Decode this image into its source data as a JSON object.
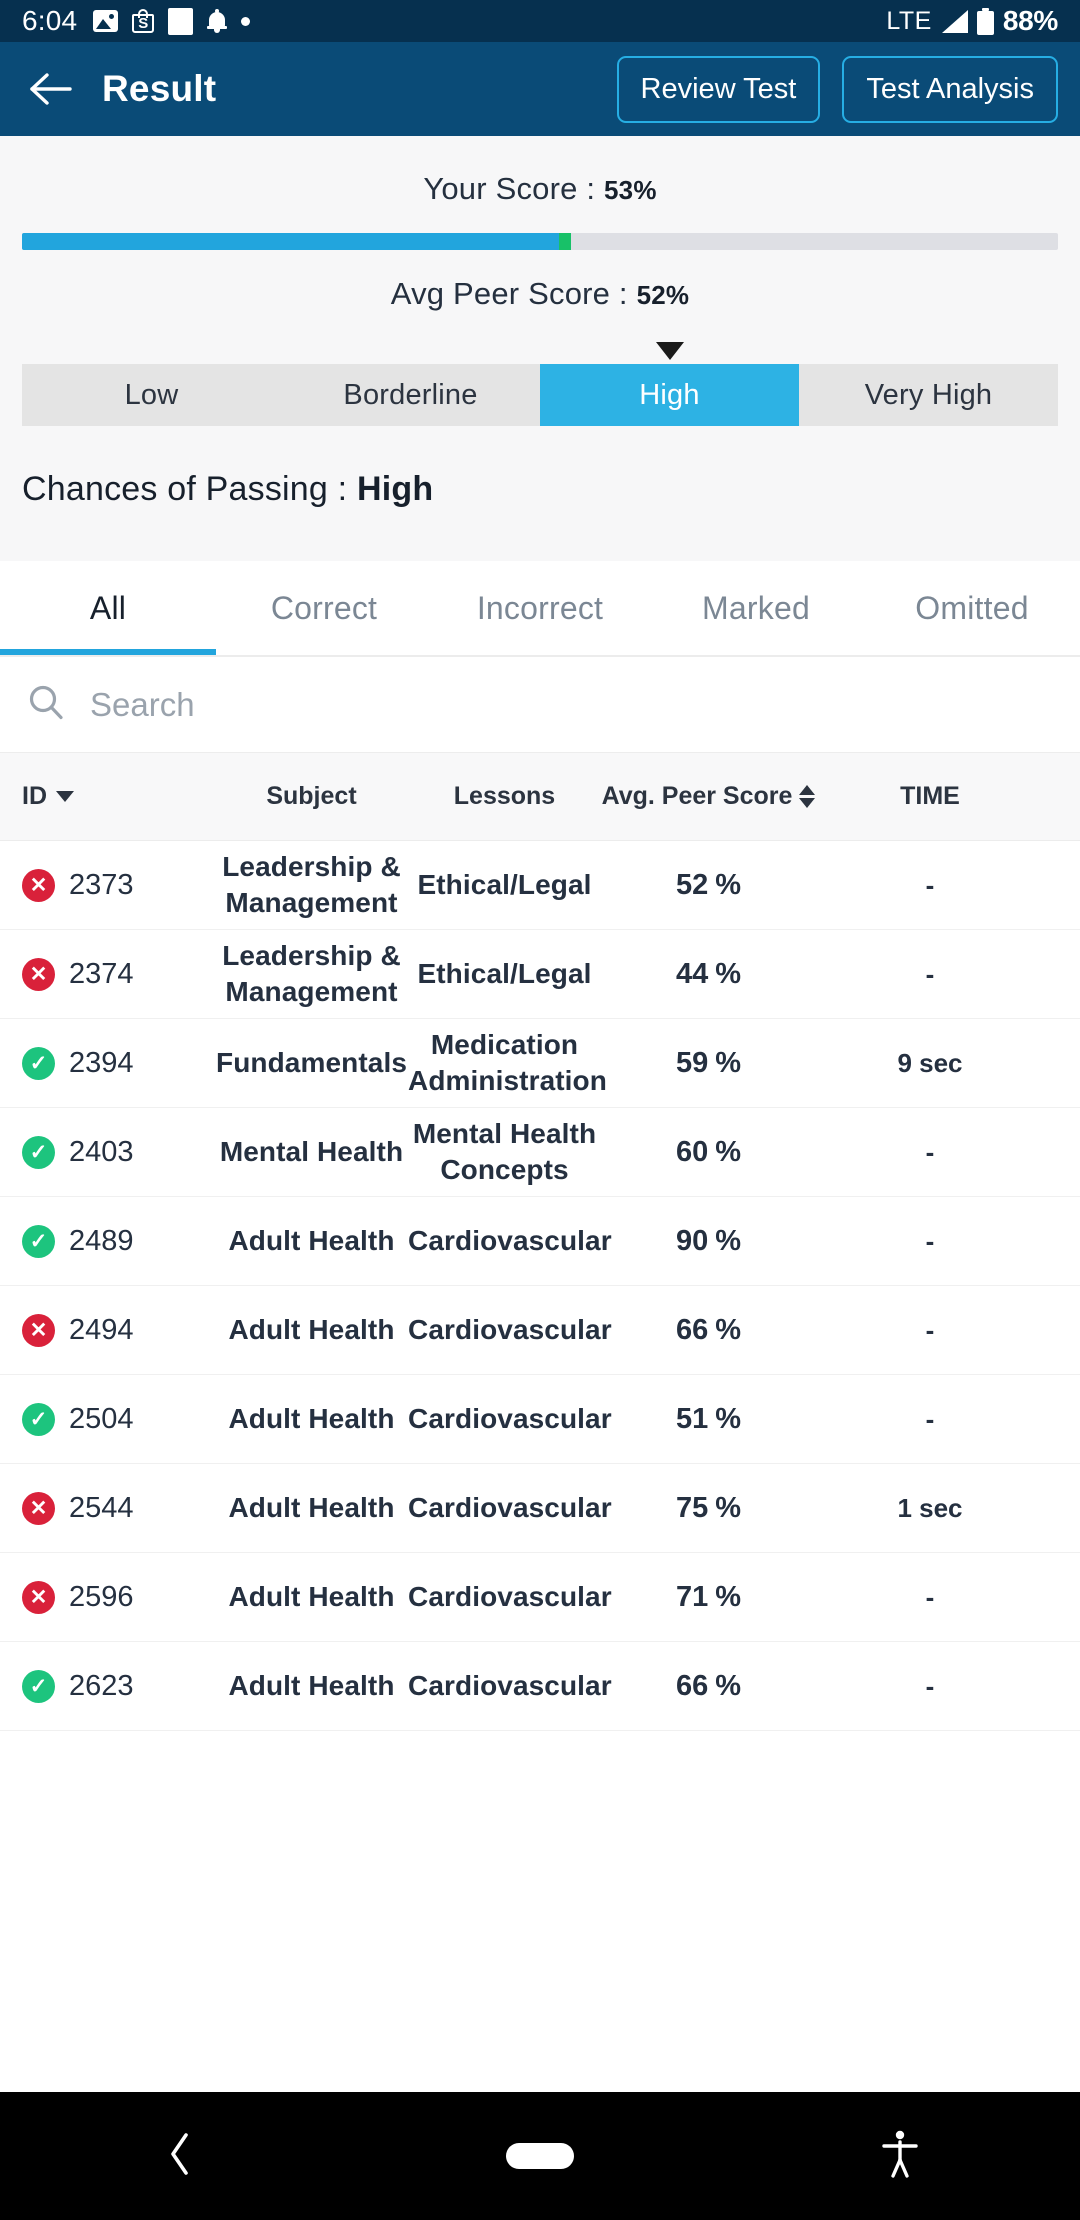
{
  "status_bar": {
    "time": "6:04",
    "network": "LTE",
    "battery_percent": "88%",
    "left_icons": [
      "image-icon",
      "shopping-bag-icon",
      "square-icon",
      "bell-icon",
      "dot-icon"
    ],
    "right_icons": [
      "signal-icon",
      "battery-icon"
    ]
  },
  "app_bar": {
    "back_icon": "back-arrow-icon",
    "title": "Result",
    "review_test_label": "Review Test",
    "test_analysis_label": "Test Analysis",
    "background_color": "#0a4b77",
    "button_border_color": "#26aee4"
  },
  "score": {
    "your_score_label": "Your Score :",
    "your_score_value": "53%",
    "your_score_percent": 53,
    "avg_peer_label": "Avg Peer Score :",
    "avg_peer_value": "52%",
    "avg_peer_percent": 52,
    "fill_color": "#22a5dd",
    "marker_color": "#18c168",
    "track_color": "#dedfe4"
  },
  "chances": {
    "segments": [
      {
        "label": "Low",
        "active": false
      },
      {
        "label": "Borderline",
        "active": false
      },
      {
        "label": "High",
        "active": true
      },
      {
        "label": "Very High",
        "active": false
      }
    ],
    "active_index": 2,
    "caret_icon": "caret-down-icon",
    "summary_label": "Chances of Passing :",
    "summary_value": "High",
    "active_color": "#2db2e4",
    "inactive_color": "#e4e4e4"
  },
  "tabs": {
    "items": [
      {
        "label": "All",
        "active": true
      },
      {
        "label": "Correct",
        "active": false
      },
      {
        "label": "Incorrect",
        "active": false
      },
      {
        "label": "Marked",
        "active": false
      },
      {
        "label": "Omitted",
        "active": false
      }
    ],
    "indicator_color": "#22a5dd"
  },
  "search": {
    "icon": "search-icon",
    "placeholder": "Search",
    "value": ""
  },
  "table": {
    "columns": [
      {
        "key": "id",
        "label": "ID",
        "sort_icon": "caret-down-icon"
      },
      {
        "key": "subject",
        "label": "Subject",
        "sort_icon": null
      },
      {
        "key": "lessons",
        "label": "Lessons",
        "sort_icon": null
      },
      {
        "key": "avg_peer_score",
        "label": "Avg. Peer Score",
        "sort_icon": "sort-updown-icon"
      },
      {
        "key": "time",
        "label": "TIME",
        "sort_icon": null
      }
    ],
    "rows": [
      {
        "status": "incorrect",
        "status_icon": "x-circle-icon",
        "id": "2373",
        "subject": "Leadership & Management",
        "lessons": "Ethical/Legal",
        "avg_peer_score": "52",
        "unit": "%",
        "time": "-"
      },
      {
        "status": "incorrect",
        "status_icon": "x-circle-icon",
        "id": "2374",
        "subject": "Leadership & Management",
        "lessons": "Ethical/Legal",
        "avg_peer_score": "44",
        "unit": "%",
        "time": "-"
      },
      {
        "status": "correct",
        "status_icon": "check-circle-icon",
        "id": "2394",
        "subject": "Fundamentals",
        "lessons": "Medication Administration",
        "avg_peer_score": "59",
        "unit": "%",
        "time": "9 sec"
      },
      {
        "status": "correct",
        "status_icon": "check-circle-icon",
        "id": "2403",
        "subject": "Mental Health",
        "lessons": "Mental Health Concepts",
        "avg_peer_score": "60",
        "unit": "%",
        "time": "-"
      },
      {
        "status": "correct",
        "status_icon": "check-circle-icon",
        "id": "2489",
        "subject": "Adult Health",
        "lessons": "Cardiovascular",
        "avg_peer_score": "90",
        "unit": "%",
        "time": "-"
      },
      {
        "status": "incorrect",
        "status_icon": "x-circle-icon",
        "id": "2494",
        "subject": "Adult Health",
        "lessons": "Cardiovascular",
        "avg_peer_score": "66",
        "unit": "%",
        "time": "-"
      },
      {
        "status": "correct",
        "status_icon": "check-circle-icon",
        "id": "2504",
        "subject": "Adult Health",
        "lessons": "Cardiovascular",
        "avg_peer_score": "51",
        "unit": "%",
        "time": "-"
      },
      {
        "status": "incorrect",
        "status_icon": "x-circle-icon",
        "id": "2544",
        "subject": "Adult Health",
        "lessons": "Cardiovascular",
        "avg_peer_score": "75",
        "unit": "%",
        "time": "1 sec"
      },
      {
        "status": "incorrect",
        "status_icon": "x-circle-icon",
        "id": "2596",
        "subject": "Adult Health",
        "lessons": "Cardiovascular",
        "avg_peer_score": "71",
        "unit": "%",
        "time": "-"
      },
      {
        "status": "correct",
        "status_icon": "check-circle-icon",
        "id": "2623",
        "subject": "Adult Health",
        "lessons": "Cardiovascular",
        "avg_peer_score": "66",
        "unit": "%",
        "time": "-"
      }
    ],
    "correct_color": "#1dc47e",
    "incorrect_color": "#d9213a",
    "correct_glyph": "✓",
    "incorrect_glyph": "✕"
  },
  "nav_bar": {
    "items": [
      {
        "icon": "back-chevron-icon",
        "label": ""
      },
      {
        "icon": "home-pill-icon",
        "label": ""
      },
      {
        "icon": "accessibility-icon",
        "label": ""
      }
    ]
  }
}
